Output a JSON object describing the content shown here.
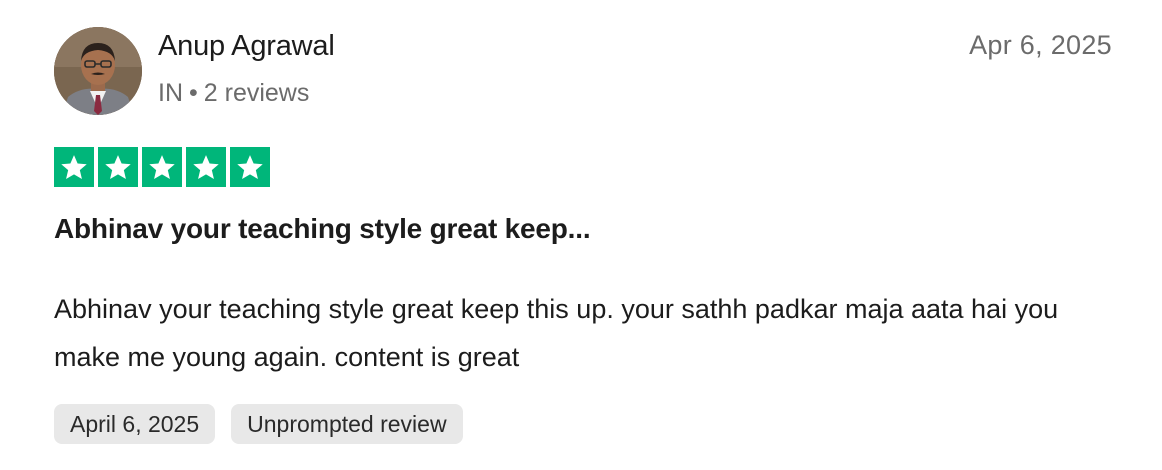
{
  "reviewer": {
    "name": "Anup Agrawal",
    "country": "IN",
    "separator": "•",
    "review_count": "2 reviews"
  },
  "review": {
    "date": "Apr 6, 2025",
    "rating": 5,
    "rating_max": 5,
    "star_color": "#00b67a",
    "title": "Abhinav your teaching style great keep...",
    "body": "Abhinav your teaching style great keep this up. your sathh padkar maja aata hai you make me young again. content is great"
  },
  "tags": [
    {
      "label": "April 6, 2025"
    },
    {
      "label": "Unprompted review"
    }
  ]
}
